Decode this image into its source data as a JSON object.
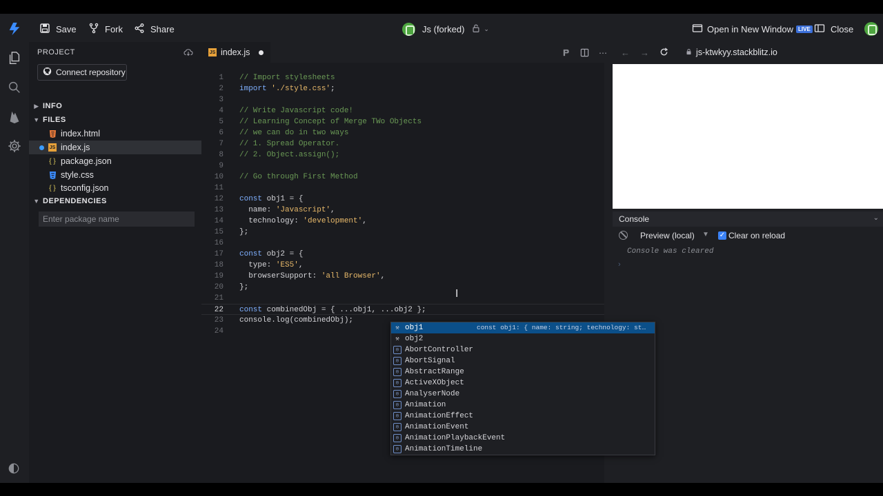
{
  "header": {
    "save_label": "Save",
    "fork_label": "Fork",
    "share_label": "Share",
    "project_title": "Js (forked)",
    "open_window_label": "Open in New Window",
    "live_badge": "LIVE",
    "close_label": "Close"
  },
  "sidebar": {
    "project_heading": "PROJECT",
    "connect_label": "Connect repository",
    "info_label": "INFO",
    "files_label": "FILES",
    "files": [
      {
        "name": "index.html",
        "type": "html"
      },
      {
        "name": "index.js",
        "type": "js",
        "active": true
      },
      {
        "name": "package.json",
        "type": "json"
      },
      {
        "name": "style.css",
        "type": "css"
      },
      {
        "name": "tsconfig.json",
        "type": "json"
      }
    ],
    "dependencies_label": "DEPENDENCIES",
    "package_placeholder": "Enter package name"
  },
  "editor": {
    "tab_label": "index.js",
    "lines": [
      "// Import stylesheets",
      "import './style.css';",
      "",
      "// Write Javascript code!",
      "// Learning Concept of Merge TWo Objects",
      "// we can do in two ways",
      "// 1. Spread Operator.",
      "// 2. Object.assign();",
      "",
      "// Go through First Method",
      "",
      "const obj1 = {",
      "  name: 'Javascript',",
      "  technology: 'development',",
      "};",
      "",
      "const obj2 = {",
      "  type: 'ES5',",
      "  browserSupport: 'all Browser',",
      "};",
      "",
      "const combinedObj = { ...obj1, ...obj2 };",
      "console.log(combinedObj);",
      ""
    ],
    "current_line": 22
  },
  "autocomplete": {
    "items": [
      {
        "label": "obj1",
        "kind": "wrench",
        "detail": "const obj1: { name: string; technology: stri…"
      },
      {
        "label": "obj2",
        "kind": "wrench"
      },
      {
        "label": "AbortController",
        "kind": "var"
      },
      {
        "label": "AbortSignal",
        "kind": "var"
      },
      {
        "label": "AbstractRange",
        "kind": "var"
      },
      {
        "label": "ActiveXObject",
        "kind": "var"
      },
      {
        "label": "AnalyserNode",
        "kind": "var"
      },
      {
        "label": "Animation",
        "kind": "var"
      },
      {
        "label": "AnimationEffect",
        "kind": "var"
      },
      {
        "label": "AnimationEvent",
        "kind": "var"
      },
      {
        "label": "AnimationPlaybackEvent",
        "kind": "var"
      },
      {
        "label": "AnimationTimeline",
        "kind": "var"
      }
    ]
  },
  "preview": {
    "url": "js-ktwkyy.stackblitz.io"
  },
  "console": {
    "title": "Console",
    "context_label": "Preview (local)",
    "clear_label": "Clear on reload",
    "cleared_message": "Console was cleared"
  },
  "colors": {
    "accent": "#3b8cff",
    "background": "#1e1f23",
    "selected_suggestion": "#0b4f89"
  }
}
